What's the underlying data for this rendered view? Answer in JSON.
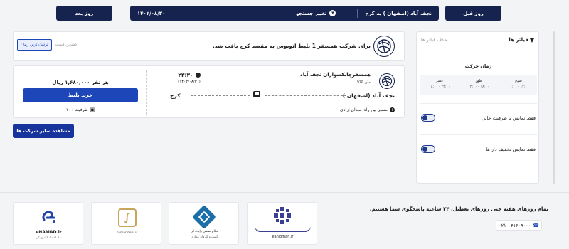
{
  "topbar": {
    "next_day": "روز بعد",
    "prev_day": "روز قبل",
    "date": "۱۴۰۲/۰۸/۳۰",
    "change_search": "تغییر جستجو",
    "route": "نجف آباد (اصفهان ) به کرج"
  },
  "notice": {
    "text": "برای شرکت همسفر 1 بلیط اتوبوس به مقصد کرج یافت شد.",
    "sort_cheapest": "کمترین قیمت",
    "sort_nearest": "نزدیک ترین زمان"
  },
  "ticket": {
    "company": "همسفرچابکسواران نجف آباد",
    "bus_type": "مان VIP",
    "time": "۲۳:۳۰",
    "date": "(۱۴۰۲/۰۸/۳۰)",
    "origin": "نجف آباد (اصفهان )",
    "destination": "کرج",
    "route_note": "مسیر بین راه: میدان آزادی",
    "price": "هر نفر ۱,۶۸۰,۰۰۰ ریال",
    "buy_label": "خرید بلیط",
    "capacity": "ظرفیت : ۱۰"
  },
  "more_companies": "مشاهده سایر شرکت ها",
  "sidebar": {
    "title": "فیلتر ها",
    "clear": "حذف فیلتر ها",
    "time_title": "زمان حرکت",
    "times": [
      {
        "name": "صبح",
        "range": "۰۰:۰۰ - ۱۲:۰۰"
      },
      {
        "name": "ظهر",
        "range": "۱۲:۰۰ - ۱۸:۰۰"
      },
      {
        "name": "عصر",
        "range": "۱۸:۰۰ - ۲۴:۰۰"
      }
    ],
    "toggle_capacity": "فقط نمایش با ظرفیت خالی",
    "toggle_discount": "فقط نمایش تخفیف دار ها"
  },
  "footer": {
    "support_text": "تمام روزهای هفته حتی روزهای تعطیل، ۲۴ ساعته پاسخگوی شما هستیم.",
    "phone": "۰۲۱ - ۴۱۶۰۹۰۰۰",
    "badges": [
      {
        "caption": "eanjoman.ir"
      },
      {
        "caption": "نظام صنفی رایانه ای",
        "sub": "کسب و کارهای مجازی"
      },
      {
        "caption": "samandehi.ir"
      },
      {
        "caption": "eNAMAD.ir",
        "sub": "نماد اعتماد الکترونیکی"
      }
    ]
  }
}
